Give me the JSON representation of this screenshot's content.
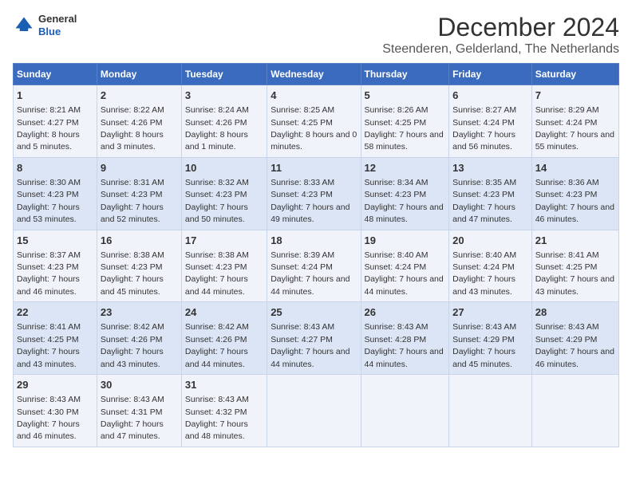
{
  "header": {
    "logo_line1": "General",
    "logo_line2": "Blue",
    "title": "December 2024",
    "subtitle": "Steenderen, Gelderland, The Netherlands"
  },
  "days_of_week": [
    "Sunday",
    "Monday",
    "Tuesday",
    "Wednesday",
    "Thursday",
    "Friday",
    "Saturday"
  ],
  "weeks": [
    [
      {
        "day": "1",
        "sunrise": "8:21 AM",
        "sunset": "4:27 PM",
        "daylight": "8 hours and 5 minutes."
      },
      {
        "day": "2",
        "sunrise": "8:22 AM",
        "sunset": "4:26 PM",
        "daylight": "8 hours and 3 minutes."
      },
      {
        "day": "3",
        "sunrise": "8:24 AM",
        "sunset": "4:26 PM",
        "daylight": "8 hours and 1 minute."
      },
      {
        "day": "4",
        "sunrise": "8:25 AM",
        "sunset": "4:25 PM",
        "daylight": "8 hours and 0 minutes."
      },
      {
        "day": "5",
        "sunrise": "8:26 AM",
        "sunset": "4:25 PM",
        "daylight": "7 hours and 58 minutes."
      },
      {
        "day": "6",
        "sunrise": "8:27 AM",
        "sunset": "4:24 PM",
        "daylight": "7 hours and 56 minutes."
      },
      {
        "day": "7",
        "sunrise": "8:29 AM",
        "sunset": "4:24 PM",
        "daylight": "7 hours and 55 minutes."
      }
    ],
    [
      {
        "day": "8",
        "sunrise": "8:30 AM",
        "sunset": "4:23 PM",
        "daylight": "7 hours and 53 minutes."
      },
      {
        "day": "9",
        "sunrise": "8:31 AM",
        "sunset": "4:23 PM",
        "daylight": "7 hours and 52 minutes."
      },
      {
        "day": "10",
        "sunrise": "8:32 AM",
        "sunset": "4:23 PM",
        "daylight": "7 hours and 50 minutes."
      },
      {
        "day": "11",
        "sunrise": "8:33 AM",
        "sunset": "4:23 PM",
        "daylight": "7 hours and 49 minutes."
      },
      {
        "day": "12",
        "sunrise": "8:34 AM",
        "sunset": "4:23 PM",
        "daylight": "7 hours and 48 minutes."
      },
      {
        "day": "13",
        "sunrise": "8:35 AM",
        "sunset": "4:23 PM",
        "daylight": "7 hours and 47 minutes."
      },
      {
        "day": "14",
        "sunrise": "8:36 AM",
        "sunset": "4:23 PM",
        "daylight": "7 hours and 46 minutes."
      }
    ],
    [
      {
        "day": "15",
        "sunrise": "8:37 AM",
        "sunset": "4:23 PM",
        "daylight": "7 hours and 46 minutes."
      },
      {
        "day": "16",
        "sunrise": "8:38 AM",
        "sunset": "4:23 PM",
        "daylight": "7 hours and 45 minutes."
      },
      {
        "day": "17",
        "sunrise": "8:38 AM",
        "sunset": "4:23 PM",
        "daylight": "7 hours and 44 minutes."
      },
      {
        "day": "18",
        "sunrise": "8:39 AM",
        "sunset": "4:24 PM",
        "daylight": "7 hours and 44 minutes."
      },
      {
        "day": "19",
        "sunrise": "8:40 AM",
        "sunset": "4:24 PM",
        "daylight": "7 hours and 44 minutes."
      },
      {
        "day": "20",
        "sunrise": "8:40 AM",
        "sunset": "4:24 PM",
        "daylight": "7 hours and 43 minutes."
      },
      {
        "day": "21",
        "sunrise": "8:41 AM",
        "sunset": "4:25 PM",
        "daylight": "7 hours and 43 minutes."
      }
    ],
    [
      {
        "day": "22",
        "sunrise": "8:41 AM",
        "sunset": "4:25 PM",
        "daylight": "7 hours and 43 minutes."
      },
      {
        "day": "23",
        "sunrise": "8:42 AM",
        "sunset": "4:26 PM",
        "daylight": "7 hours and 43 minutes."
      },
      {
        "day": "24",
        "sunrise": "8:42 AM",
        "sunset": "4:26 PM",
        "daylight": "7 hours and 44 minutes."
      },
      {
        "day": "25",
        "sunrise": "8:43 AM",
        "sunset": "4:27 PM",
        "daylight": "7 hours and 44 minutes."
      },
      {
        "day": "26",
        "sunrise": "8:43 AM",
        "sunset": "4:28 PM",
        "daylight": "7 hours and 44 minutes."
      },
      {
        "day": "27",
        "sunrise": "8:43 AM",
        "sunset": "4:29 PM",
        "daylight": "7 hours and 45 minutes."
      },
      {
        "day": "28",
        "sunrise": "8:43 AM",
        "sunset": "4:29 PM",
        "daylight": "7 hours and 46 minutes."
      }
    ],
    [
      {
        "day": "29",
        "sunrise": "8:43 AM",
        "sunset": "4:30 PM",
        "daylight": "7 hours and 46 minutes."
      },
      {
        "day": "30",
        "sunrise": "8:43 AM",
        "sunset": "4:31 PM",
        "daylight": "7 hours and 47 minutes."
      },
      {
        "day": "31",
        "sunrise": "8:43 AM",
        "sunset": "4:32 PM",
        "daylight": "7 hours and 48 minutes."
      },
      null,
      null,
      null,
      null
    ]
  ]
}
